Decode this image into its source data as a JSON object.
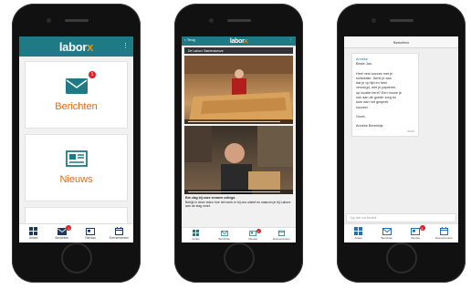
{
  "colors": {
    "teal": "#1e7b85",
    "orange": "#e06b14",
    "badge": "#dd2222"
  },
  "phone1": {
    "logo_main": "labor",
    "logo_accent": "x",
    "menu_icon": "kebab-icon",
    "tiles": [
      {
        "label": "Berichten",
        "icon": "envelope-icon",
        "badge": "1"
      },
      {
        "label": "Nieuws",
        "icon": "newspaper-icon"
      },
      {
        "label": "",
        "icon": "calendar-icon"
      }
    ],
    "tabs": [
      {
        "label": "Acties",
        "icon": "grid-icon"
      },
      {
        "label": "Berichten",
        "icon": "envelope-icon",
        "badge": "1"
      },
      {
        "label": "Nieuws",
        "icon": "newspaper-icon"
      },
      {
        "label": "Evenementen",
        "icon": "calendar-icon"
      }
    ]
  },
  "phone2": {
    "back_label": "< Terug",
    "logo_main": "labor",
    "logo_accent": "x",
    "strip_label": "De Laborx Starterskeuze",
    "caption_title": "Een dag bij onze ervaren collega",
    "caption_text": "Bekijk in deze video hoe het werk er bij ons uitziet en waarom je bij Laborx aan de slag moet.",
    "tabs": [
      {
        "label": "Acties",
        "icon": "grid-icon"
      },
      {
        "label": "Berichten",
        "icon": "envelope-icon"
      },
      {
        "label": "Nieuws",
        "icon": "newspaper-icon",
        "badge": "1"
      },
      {
        "label": "Evenementen",
        "icon": "calendar-icon"
      }
    ]
  },
  "phone3": {
    "title": "Berichten",
    "message": {
      "from": "Anneke",
      "lines": [
        "Beste Jan,",
        "",
        "Heel veel succes met je",
        "sollicitatie. Denk je aan",
        "dat je op tijd en heel",
        "verzorgd, met je papieren,",
        "op locatie bent? Een mooie je",
        "ook aan de goede zorg en",
        "kom dan het gesprek",
        "succes!",
        "",
        "Groet,",
        "",
        "Anneke Berenkijs"
      ],
      "time": "09:46"
    },
    "input_placeholder": "Typ hier uw bericht",
    "tabs": [
      {
        "label": "Acties",
        "icon": "grid-icon"
      },
      {
        "label": "Berichten",
        "icon": "envelope-icon"
      },
      {
        "label": "Nieuws",
        "icon": "newspaper-icon",
        "badge": "1"
      },
      {
        "label": "Evenementen",
        "icon": "calendar-icon"
      }
    ]
  }
}
